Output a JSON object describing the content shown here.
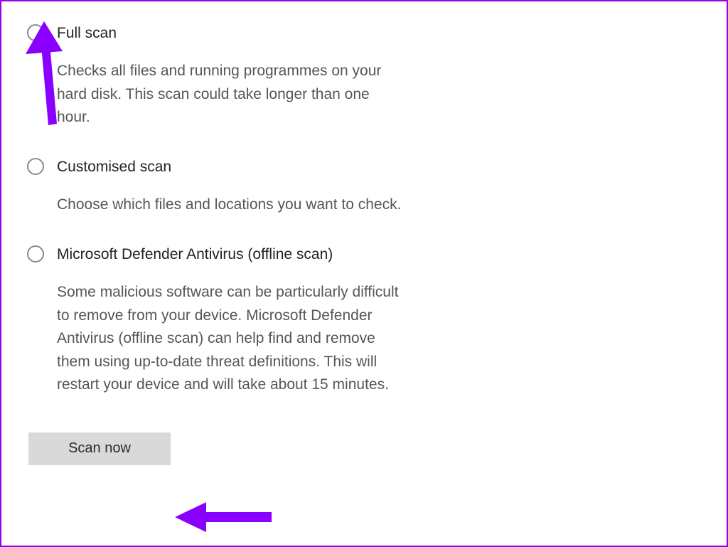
{
  "scanOptions": {
    "fullScan": {
      "title": "Full scan",
      "description": "Checks all files and running programmes on your hard disk. This scan could take longer than one hour."
    },
    "customisedScan": {
      "title": "Customised scan",
      "description": "Choose which files and locations you want to check."
    },
    "offlineScan": {
      "title": "Microsoft Defender Antivirus (offline scan)",
      "description": "Some malicious software can be particularly difficult to remove from your device. Microsoft Defender Antivirus (offline scan) can help find and remove them using up-to-date threat definitions. This will restart your device and will take about 15 minutes."
    }
  },
  "buttons": {
    "scanNow": "Scan now"
  },
  "annotationColor": "#8a00ff"
}
